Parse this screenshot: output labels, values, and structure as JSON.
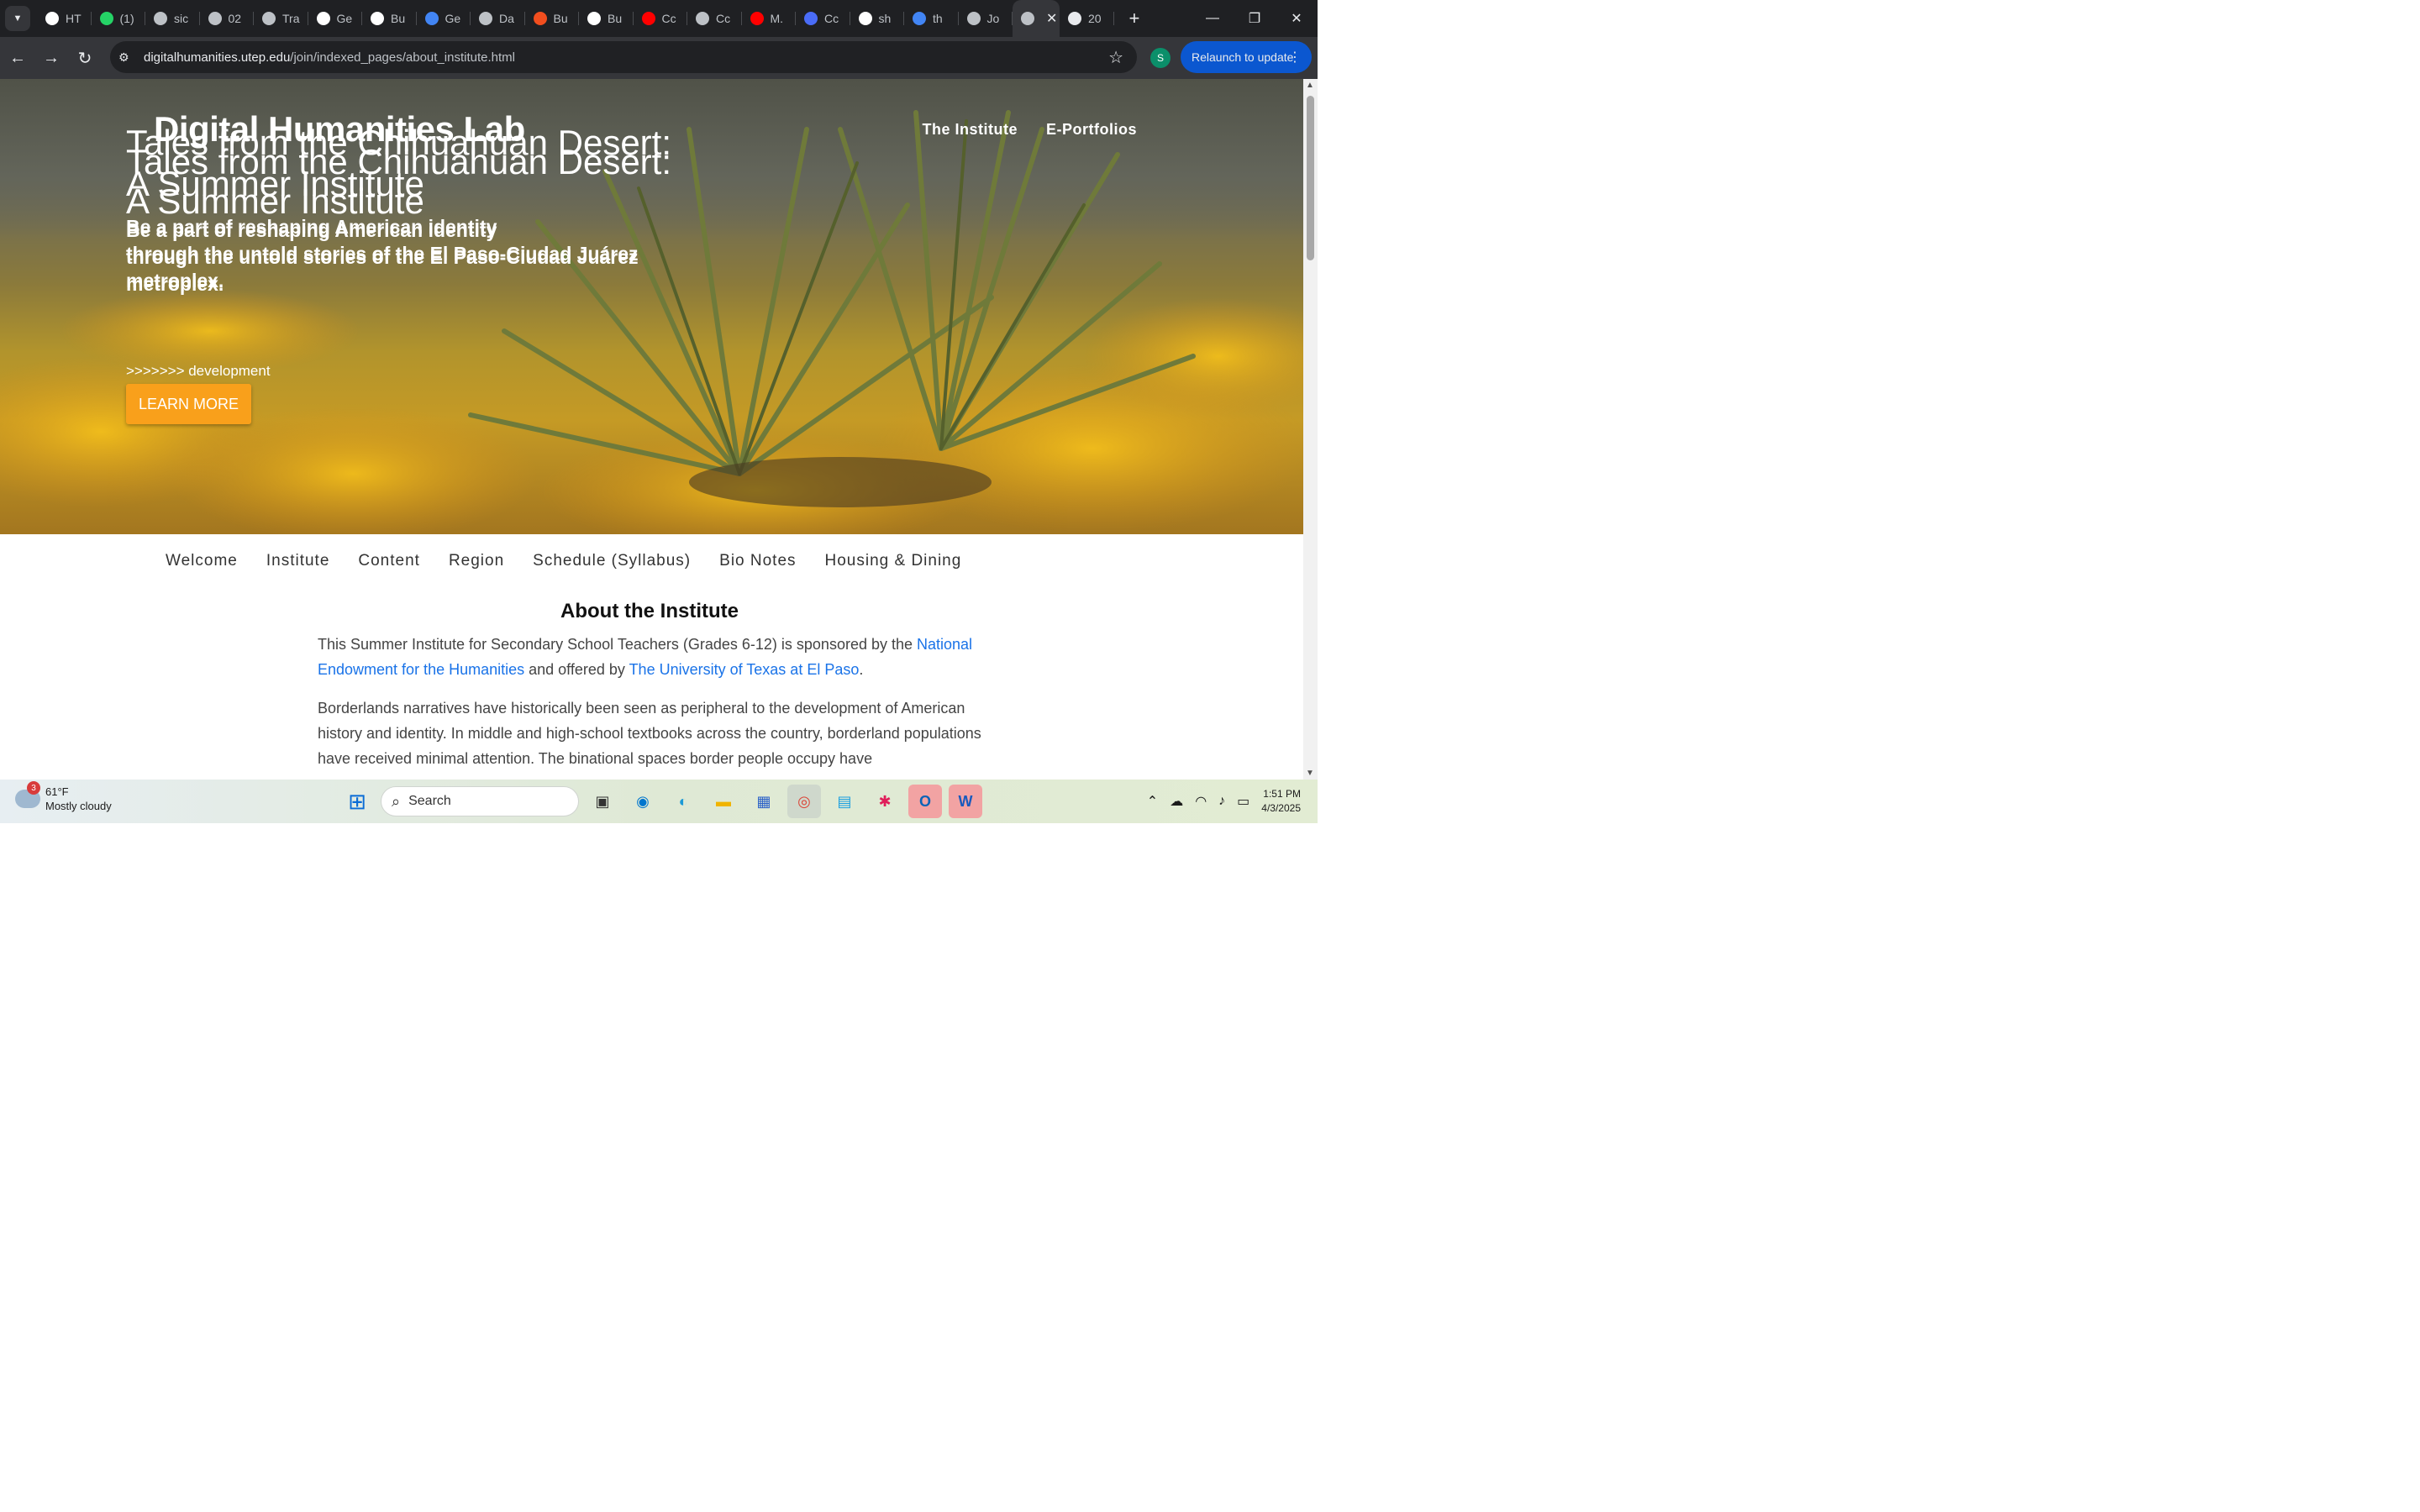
{
  "browser": {
    "tabs": [
      {
        "label": "HT",
        "icon": "openai-icon",
        "color": "#ffffff"
      },
      {
        "label": "(1)",
        "icon": "whatsapp-icon",
        "color": "#25d366"
      },
      {
        "label": "sic",
        "icon": "globe-icon",
        "color": "#bdc1c6"
      },
      {
        "label": "02",
        "icon": "globe-icon",
        "color": "#bdc1c6"
      },
      {
        "label": "Tra",
        "icon": "globe-icon",
        "color": "#bdc1c6"
      },
      {
        "label": "Ge",
        "icon": "gemini-icon",
        "color": "#ffffff"
      },
      {
        "label": "Bu",
        "icon": "bolt-icon",
        "color": "#ffffff"
      },
      {
        "label": "Ge",
        "icon": "google-g-icon",
        "color": "#4285f4"
      },
      {
        "label": "Da",
        "icon": "globe-icon",
        "color": "#bdc1c6"
      },
      {
        "label": "Bu",
        "icon": "figma-icon",
        "color": "#f24e1e"
      },
      {
        "label": "Bu",
        "icon": "bolt-icon",
        "color": "#ffffff"
      },
      {
        "label": "Cc",
        "icon": "youtube-icon",
        "color": "#ff0000"
      },
      {
        "label": "Cc",
        "icon": "globe-icon",
        "color": "#bdc1c6"
      },
      {
        "label": "M.",
        "icon": "youtube-icon",
        "color": "#ff0000"
      },
      {
        "label": "Cc",
        "icon": "codemagic-icon",
        "color": "#4a6cf7"
      },
      {
        "label": "sh",
        "icon": "github-icon",
        "color": "#ffffff"
      },
      {
        "label": "th",
        "icon": "google-icon",
        "color": "#4285f4"
      },
      {
        "label": "Jo",
        "icon": "globe-icon",
        "color": "#bdc1c6"
      }
    ],
    "active_tab": {
      "icon": "globe-icon",
      "close": "✕"
    },
    "after_tab": {
      "label": "20",
      "icon": "chatgpt-icon"
    },
    "new_tab": "+",
    "url_domain": "digitalhumanities.utep.edu",
    "url_path": "/join/indexed_pages/about_institute.html",
    "profile_initial": "S",
    "relaunch_label": "Relaunch to update"
  },
  "site": {
    "brand": "Digital Humanities Lab",
    "top_nav": [
      "The Institute",
      "E-Portfolios"
    ],
    "hero_title_line1": "Tales from the Chihuahuan Desert:",
    "hero_title_line2": "A Summer Institute",
    "hero_sub_line1": "Be a part of reshaping American identity",
    "hero_sub_line2": "through the untold stories of the El Paso-Ciudad Juárez",
    "hero_sub_line3": "metroplex.",
    "dev_note": ">>>>>>> development",
    "learn_more": "LEARN MORE",
    "section_nav": [
      "Welcome",
      "Institute",
      "Content",
      "Region",
      "Schedule (Syllabus)",
      "Bio Notes",
      "Housing & Dining"
    ],
    "article_title": "About the Institute",
    "p1_before": "This Summer Institute for Secondary School Teachers (Grades 6-12) is sponsored by the ",
    "p1_link1": "National Endowment for the Humanities",
    "p1_mid": " and offered by ",
    "p1_link2": "The University of Texas at El Paso",
    "p1_end": ".",
    "p2": "Borderlands narratives have historically been seen as peripheral to the development of American history and identity. In middle and high-school textbooks across the country, borderland populations have received minimal attention. The binational spaces border people occupy have"
  },
  "taskbar": {
    "weather_temp": "61°F",
    "weather_desc": "Mostly cloudy",
    "weather_badge": "3",
    "search_placeholder": "Search",
    "time": "1:51 PM",
    "date": "4/3/2025"
  }
}
